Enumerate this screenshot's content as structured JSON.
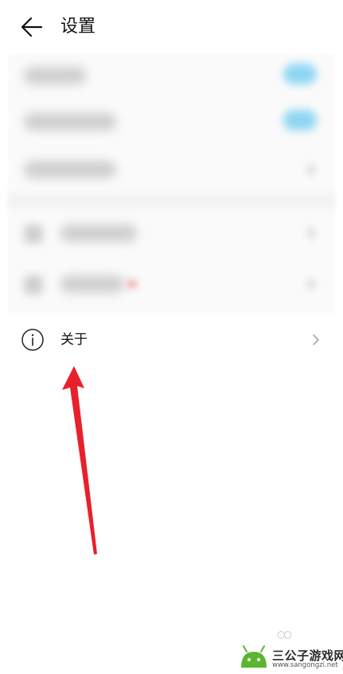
{
  "header": {
    "back_icon": "arrow-left-icon",
    "title": "设置"
  },
  "about_item": {
    "icon": "info-circle-icon",
    "label": "关于",
    "chevron": "chevron-right-icon"
  },
  "annotation": {
    "arrow_color": "#e8202b"
  },
  "watermark": {
    "name": "三公子游戏网",
    "url": "www.sangongzi.net",
    "logo_color": "#5cb531"
  },
  "colors": {
    "toggle_on": "#8fd6f3",
    "text_primary": "#111111"
  }
}
